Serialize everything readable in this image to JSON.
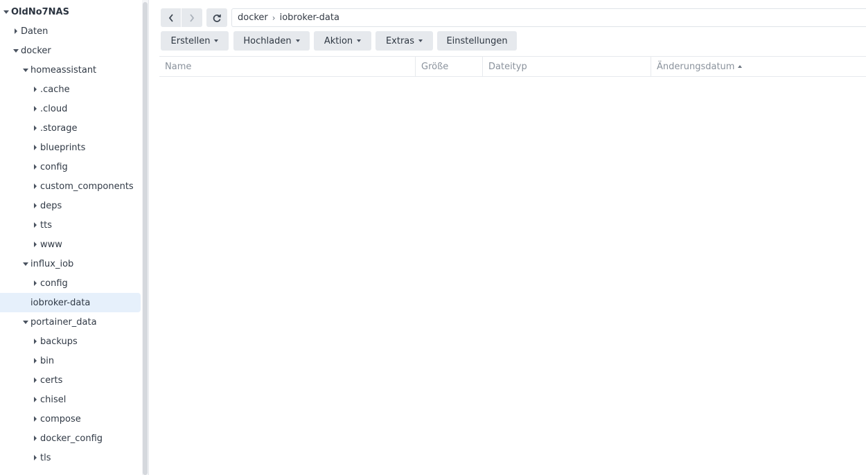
{
  "sidebar": {
    "items": [
      {
        "label": "OldNo7NAS",
        "state": "expanded",
        "level": 0,
        "root": true
      },
      {
        "label": "Daten",
        "state": "collapsed",
        "level": 1
      },
      {
        "label": "docker",
        "state": "expanded",
        "level": 1
      },
      {
        "label": "homeassistant",
        "state": "expanded",
        "level": 2
      },
      {
        "label": ".cache",
        "state": "collapsed",
        "level": 3
      },
      {
        "label": ".cloud",
        "state": "collapsed",
        "level": 3
      },
      {
        "label": ".storage",
        "state": "collapsed",
        "level": 3
      },
      {
        "label": "blueprints",
        "state": "collapsed",
        "level": 3
      },
      {
        "label": "config",
        "state": "collapsed",
        "level": 3
      },
      {
        "label": "custom_components",
        "state": "collapsed",
        "level": 3
      },
      {
        "label": "deps",
        "state": "collapsed",
        "level": 3
      },
      {
        "label": "tts",
        "state": "collapsed",
        "level": 3
      },
      {
        "label": "www",
        "state": "collapsed",
        "level": 3
      },
      {
        "label": "influx_iob",
        "state": "expanded",
        "level": 2
      },
      {
        "label": "config",
        "state": "collapsed",
        "level": 3
      },
      {
        "label": "iobroker-data",
        "state": "leaf",
        "level": 2,
        "selected": true
      },
      {
        "label": "portainer_data",
        "state": "expanded",
        "level": 2
      },
      {
        "label": "backups",
        "state": "collapsed",
        "level": 3
      },
      {
        "label": "bin",
        "state": "collapsed",
        "level": 3
      },
      {
        "label": "certs",
        "state": "collapsed",
        "level": 3
      },
      {
        "label": "chisel",
        "state": "collapsed",
        "level": 3
      },
      {
        "label": "compose",
        "state": "collapsed",
        "level": 3
      },
      {
        "label": "docker_config",
        "state": "collapsed",
        "level": 3
      },
      {
        "label": "tls",
        "state": "collapsed",
        "level": 3
      }
    ]
  },
  "nav": {
    "back_icon": "chevron-left-icon",
    "forward_icon": "chevron-right-icon",
    "refresh_icon": "refresh-icon"
  },
  "path": {
    "segments": [
      "docker",
      "iobroker-data"
    ],
    "separator": "›"
  },
  "toolbar": {
    "create_label": "Erstellen",
    "upload_label": "Hochladen",
    "action_label": "Aktion",
    "extras_label": "Extras",
    "settings_label": "Einstellungen"
  },
  "table": {
    "columns": {
      "name": "Name",
      "size": "Größe",
      "type": "Dateityp",
      "modified": "Änderungsdatum"
    },
    "rows": []
  }
}
